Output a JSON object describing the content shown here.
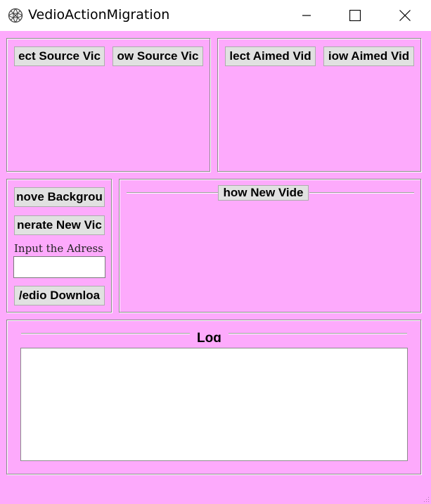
{
  "window": {
    "title": "VedioActionMigration",
    "icon": "app-icon",
    "controls": [
      "minimize-icon",
      "maximize-icon",
      "close-icon"
    ]
  },
  "source_panel": {
    "select_button": "ect Source Vic",
    "show_button": "ow Source Vic"
  },
  "aimed_panel": {
    "select_button": "lect Aimed Vid",
    "show_button": "iow Aimed Vid"
  },
  "actions_panel": {
    "remove_background_button": "nove Backgrou",
    "generate_button": "nerate New Vic",
    "address_label": "Input the Adress",
    "address_value": "",
    "download_button": "/edio Downloa"
  },
  "new_video_panel": {
    "show_button": "how New Vide"
  },
  "log_panel": {
    "title": "Log",
    "content": ""
  },
  "colors": {
    "background": "#fdaafc",
    "button": "#e1e1e1"
  }
}
